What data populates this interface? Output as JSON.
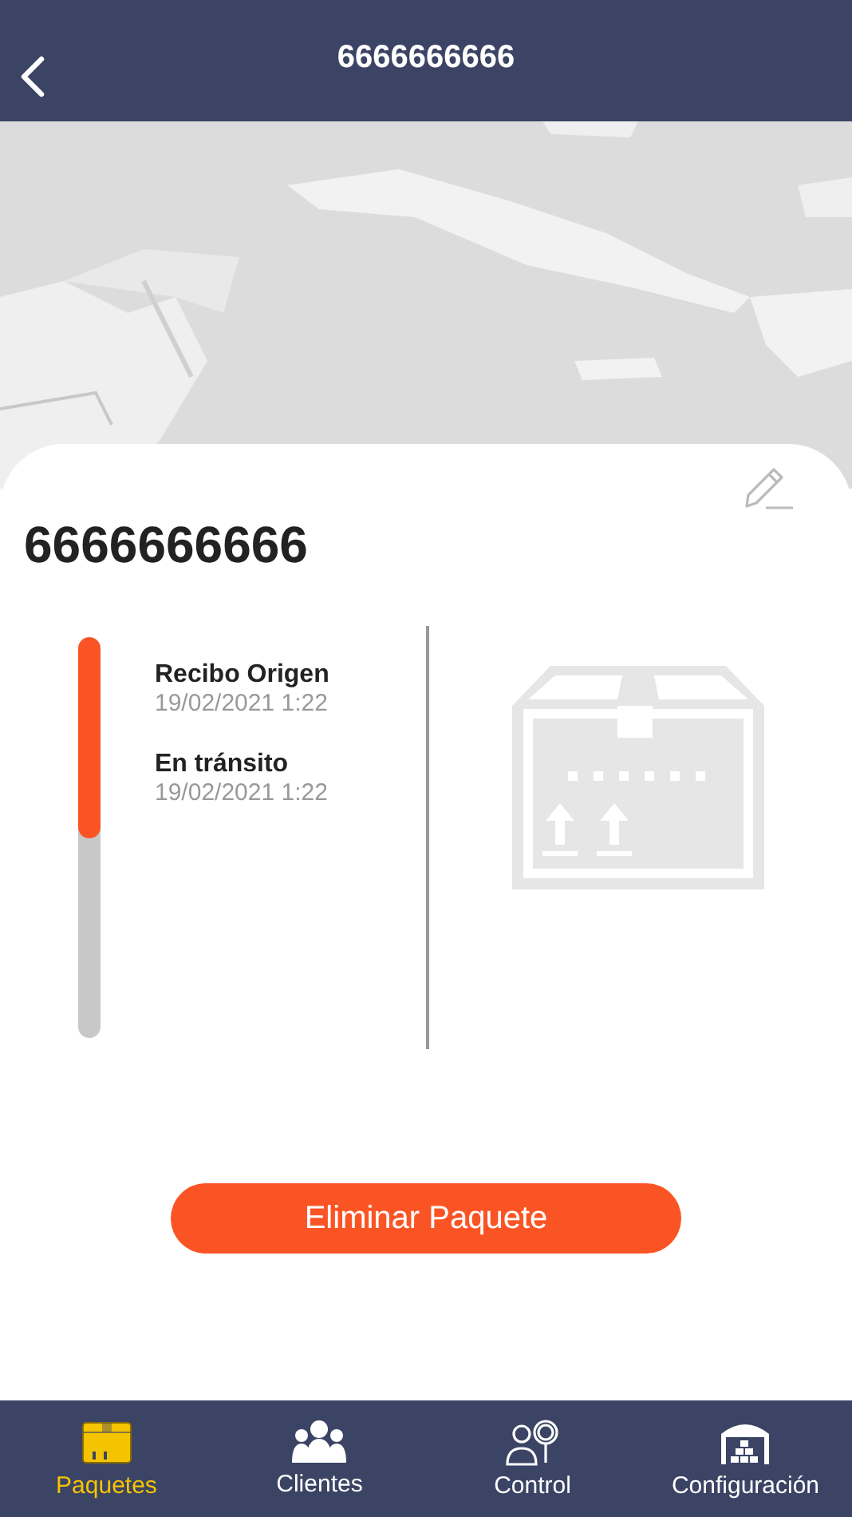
{
  "header": {
    "title": "6666666666"
  },
  "package": {
    "title": "6666666666"
  },
  "timeline": {
    "level": 0.5,
    "events": [
      {
        "title": "Recibo Origen",
        "date": "19/02/2021 1:22"
      },
      {
        "title": "En tránsito",
        "date": "19/02/2021 1:22"
      }
    ]
  },
  "delete_button": {
    "label": "Eliminar Paquete"
  },
  "tabs": [
    {
      "label": "Paquetes",
      "kind": "box",
      "selected": true
    },
    {
      "label": "Clientes",
      "kind": "people",
      "selected": false
    },
    {
      "label": "Control",
      "kind": "inspector",
      "selected": false
    },
    {
      "label": "Configuración",
      "kind": "warehouse",
      "selected": false
    }
  ]
}
